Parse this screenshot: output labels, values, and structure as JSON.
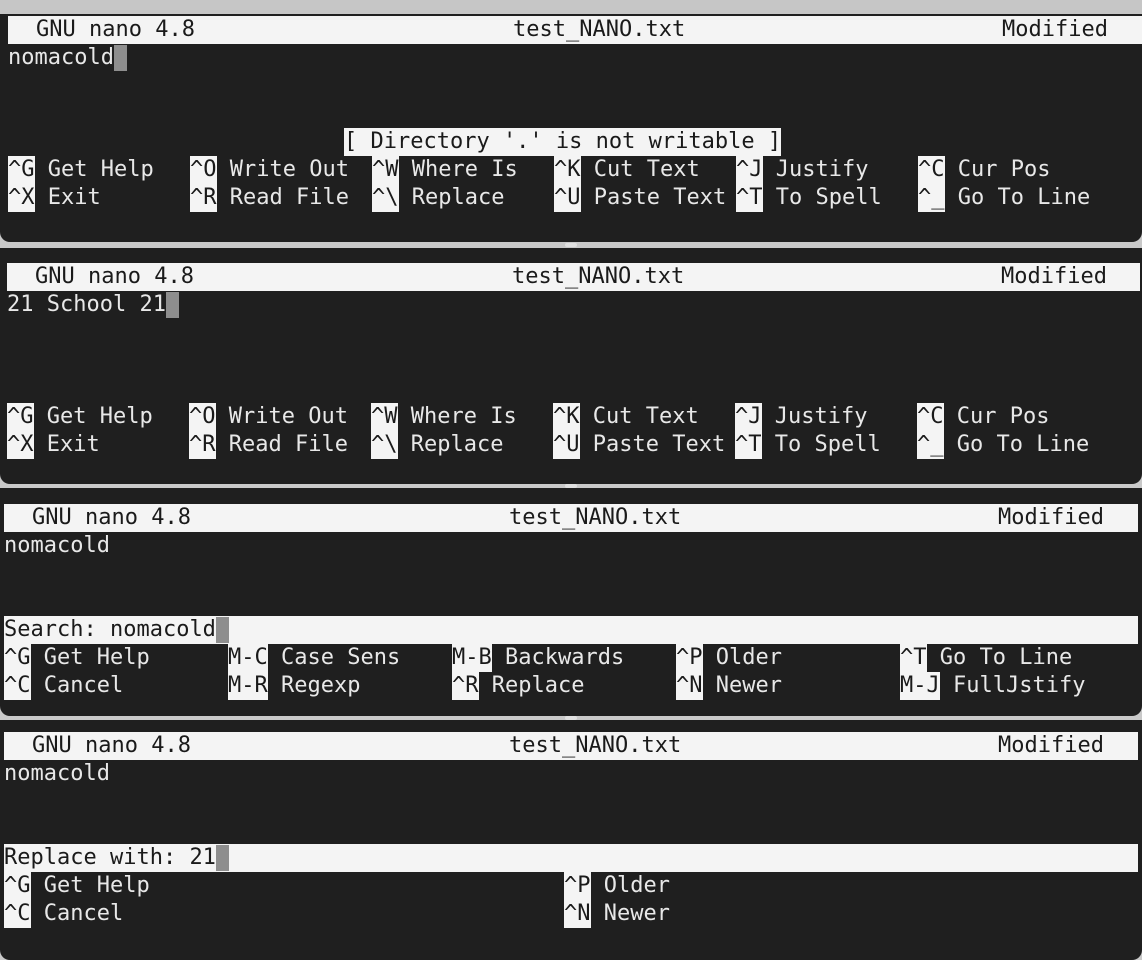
{
  "panes": [
    {
      "title": {
        "app": "GNU nano 4.8",
        "file": "test_NANO.txt",
        "status": "Modified"
      },
      "buffer": "nomacold",
      "message": "[ Directory '.' is not writable ]",
      "shortcuts_row1": [
        {
          "key": "^G",
          "label": "Get Help"
        },
        {
          "key": "^O",
          "label": "Write Out"
        },
        {
          "key": "^W",
          "label": "Where Is"
        },
        {
          "key": "^K",
          "label": "Cut Text"
        },
        {
          "key": "^J",
          "label": "Justify"
        },
        {
          "key": "^C",
          "label": "Cur Pos"
        }
      ],
      "shortcuts_row2": [
        {
          "key": "^X",
          "label": "Exit"
        },
        {
          "key": "^R",
          "label": "Read File"
        },
        {
          "key": "^\\",
          "label": "Replace"
        },
        {
          "key": "^U",
          "label": "Paste Text"
        },
        {
          "key": "^T",
          "label": "To Spell"
        },
        {
          "key": "^_",
          "label": "Go To Line"
        }
      ]
    },
    {
      "title": {
        "app": "GNU nano 4.8",
        "file": "test_NANO.txt",
        "status": "Modified"
      },
      "buffer": "21 School 21",
      "shortcuts_row1": [
        {
          "key": "^G",
          "label": "Get Help"
        },
        {
          "key": "^O",
          "label": "Write Out"
        },
        {
          "key": "^W",
          "label": "Where Is"
        },
        {
          "key": "^K",
          "label": "Cut Text"
        },
        {
          "key": "^J",
          "label": "Justify"
        },
        {
          "key": "^C",
          "label": "Cur Pos"
        }
      ],
      "shortcuts_row2": [
        {
          "key": "^X",
          "label": "Exit"
        },
        {
          "key": "^R",
          "label": "Read File"
        },
        {
          "key": "^\\",
          "label": "Replace"
        },
        {
          "key": "^U",
          "label": "Paste Text"
        },
        {
          "key": "^T",
          "label": "To Spell"
        },
        {
          "key": "^_",
          "label": "Go To Line"
        }
      ]
    },
    {
      "title": {
        "app": "GNU nano 4.8",
        "file": "test_NANO.txt",
        "status": "Modified"
      },
      "buffer": "nomacold",
      "prompt": {
        "label": "Search: ",
        "value": "nomacold"
      },
      "shortcuts_row1": [
        {
          "key": "^G",
          "label": "Get Help"
        },
        {
          "key": "M-C",
          "label": "Case Sens"
        },
        {
          "key": "M-B",
          "label": "Backwards"
        },
        {
          "key": "^P",
          "label": "Older"
        },
        {
          "key": "^T",
          "label": "Go To Line"
        }
      ],
      "shortcuts_row2": [
        {
          "key": "^C",
          "label": "Cancel"
        },
        {
          "key": "M-R",
          "label": "Regexp"
        },
        {
          "key": "^R",
          "label": "Replace"
        },
        {
          "key": "^N",
          "label": "Newer"
        },
        {
          "key": "M-J",
          "label": "FullJstify"
        }
      ]
    },
    {
      "title": {
        "app": "GNU nano 4.8",
        "file": "test_NANO.txt",
        "status": "Modified"
      },
      "buffer": "nomacold",
      "prompt": {
        "label": "Replace with: ",
        "value": "21"
      },
      "shortcuts_row1": [
        {
          "key": "^G",
          "label": "Get Help"
        },
        {
          "key": "^P",
          "label": "Older"
        }
      ],
      "shortcuts_row2": [
        {
          "key": "^C",
          "label": "Cancel"
        },
        {
          "key": "^N",
          "label": "Newer"
        }
      ]
    }
  ]
}
